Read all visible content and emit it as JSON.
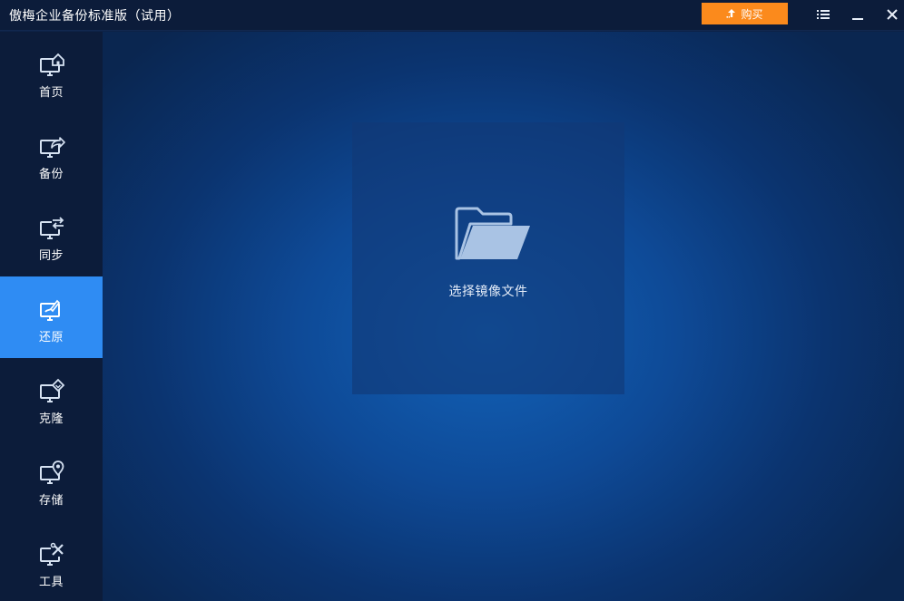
{
  "window": {
    "title": "傲梅企业备份标准版（试用）"
  },
  "titlebar": {
    "buy_label": "购买",
    "buy_color": "#fb8a1c",
    "menu_icon": "list-menu-icon",
    "minimize_icon": "minimize-icon",
    "close_icon": "close-icon"
  },
  "sidebar": {
    "active_color": "#2f8cf3",
    "items": [
      {
        "label": "首页",
        "icon": "monitor-home-icon",
        "active": false
      },
      {
        "label": "备份",
        "icon": "monitor-share-icon",
        "active": false
      },
      {
        "label": "同步",
        "icon": "monitor-sync-icon",
        "active": false
      },
      {
        "label": "还原",
        "icon": "monitor-restore-icon",
        "active": true
      },
      {
        "label": "克隆",
        "icon": "monitor-clone-icon",
        "active": false
      },
      {
        "label": "存储",
        "icon": "monitor-location-icon",
        "active": false
      },
      {
        "label": "工具",
        "icon": "monitor-tools-icon",
        "active": false
      }
    ]
  },
  "main": {
    "select_image_label": "选择镜像文件",
    "panel_icon": "folder-open-icon"
  }
}
